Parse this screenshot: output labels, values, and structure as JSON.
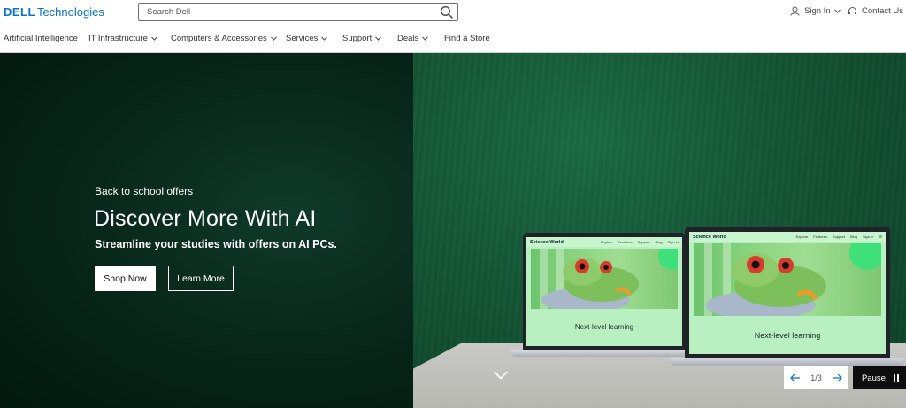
{
  "header": {
    "logo": {
      "dell": "DELL",
      "tech": "Technologies"
    },
    "search": {
      "placeholder": "Search Dell"
    },
    "sign_in": "Sign In",
    "contact_us": "Contact Us"
  },
  "nav": {
    "items": [
      {
        "label": "Artificial Intelligence",
        "has_menu": false
      },
      {
        "label": "IT Infrastructure",
        "has_menu": true
      },
      {
        "label": "Computers & Accessories",
        "has_menu": true
      },
      {
        "label": "Services",
        "has_menu": true
      },
      {
        "label": "Support",
        "has_menu": true
      },
      {
        "label": "Deals",
        "has_menu": true
      },
      {
        "label": "Find a Store",
        "has_menu": false
      }
    ]
  },
  "hero": {
    "eyebrow": "Back to school offers",
    "headline": "Discover More With AI",
    "subline": "Streamline your studies with offers on AI PCs.",
    "shop_now": "Shop Now",
    "learn_more": "Learn More",
    "laptop_screen": {
      "brand": "Science World",
      "nav": [
        "Explore",
        "Features",
        "Support",
        "Blog",
        "Sign In"
      ],
      "caption": "Next-level learning"
    }
  },
  "carousel": {
    "page": "1/3",
    "pause_label": "Pause"
  },
  "colors": {
    "brand_blue": "#0672cb",
    "hero_dark": "#062216",
    "hero_green": "#145535"
  }
}
